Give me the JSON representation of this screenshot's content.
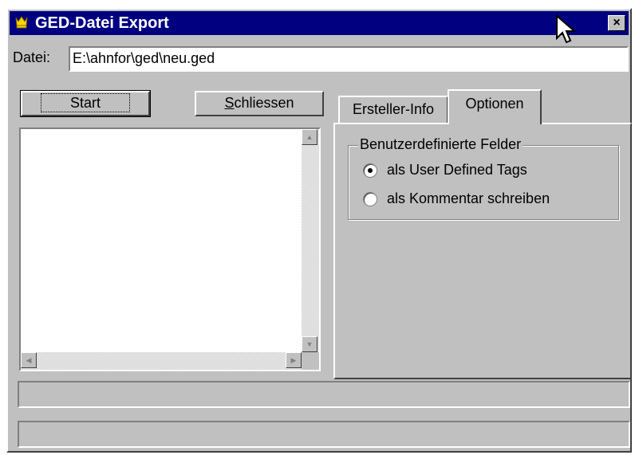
{
  "window": {
    "title": "GED-Datei Export",
    "close_label": "×"
  },
  "file": {
    "label": "Datei:",
    "value": "E:\\ahnfor\\ged\\neu.ged"
  },
  "buttons": {
    "start_label": "Start",
    "close_label_u": "S",
    "close_label_rest": "chliessen"
  },
  "tabs": [
    {
      "label": "Ersteller-Info",
      "active": false
    },
    {
      "label": "Optionen",
      "active": true
    }
  ],
  "options": {
    "group_title": "Benutzerdefinierte Felder",
    "radios": [
      {
        "label": "als User Defined Tags",
        "selected": true
      },
      {
        "label": "als Kommentar schreiben",
        "selected": false
      }
    ]
  },
  "status_bars": [
    "",
    ""
  ],
  "colors": {
    "titlebar": "#000080",
    "face": "#c0c0c0"
  },
  "icons": [
    "app-icon",
    "close-icon",
    "mouse-cursor-icon",
    "scroll-up-icon",
    "scroll-down-icon",
    "scroll-left-icon",
    "scroll-right-icon"
  ]
}
